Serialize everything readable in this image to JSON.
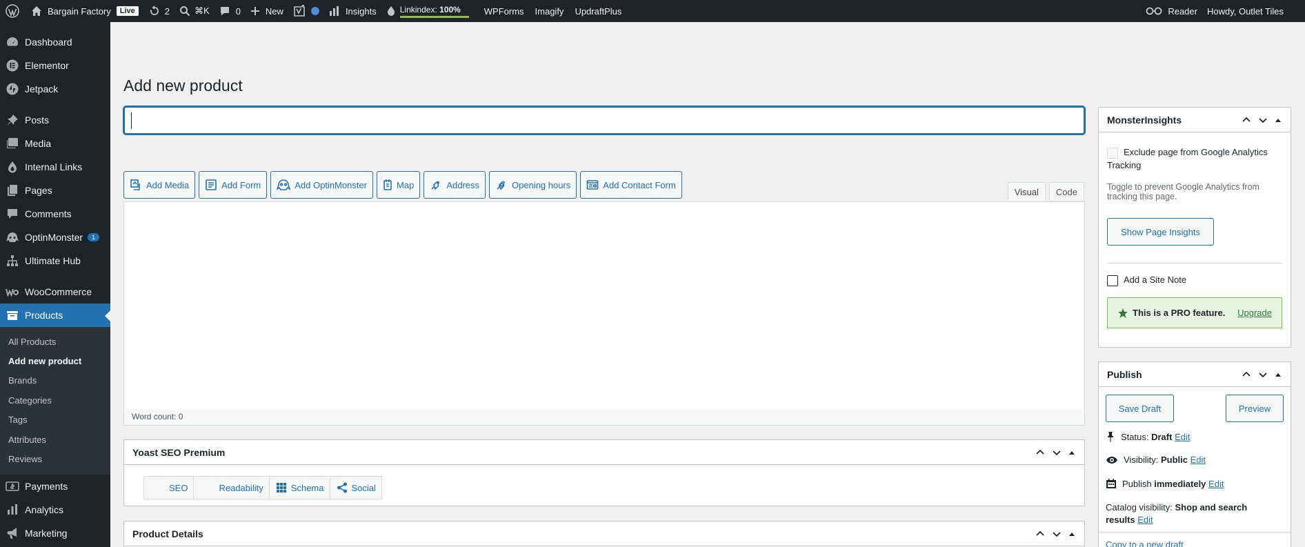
{
  "admin_bar": {
    "site_name": "Bargain Factory",
    "live_badge": "Live",
    "updates_count": "2",
    "search_shortcut": "⌘K",
    "comments_count": "0",
    "new_label": "New",
    "insights_label": "Insights",
    "linkindex_label": "Linkindex:",
    "linkindex_value": "100%",
    "wpforms_label": "WPForms",
    "imagify_label": "Imagify",
    "updraft_label": "UpdraftPlus",
    "reader_label": "Reader",
    "howdy_label": "Howdy, Outlet Tiles"
  },
  "sidebar": {
    "items": [
      {
        "label": "Dashboard",
        "icon": "dashboard-icon"
      },
      {
        "label": "Elementor",
        "icon": "elementor-icon"
      },
      {
        "label": "Jetpack",
        "icon": "jetpack-icon"
      },
      {
        "label": "Posts",
        "icon": "pin-icon"
      },
      {
        "label": "Media",
        "icon": "media-icon"
      },
      {
        "label": "Internal Links",
        "icon": "link-icon"
      },
      {
        "label": "Pages",
        "icon": "pages-icon"
      },
      {
        "label": "Comments",
        "icon": "comment-icon"
      },
      {
        "label": "OptinMonster",
        "icon": "optinmonster-icon",
        "badge": "1"
      },
      {
        "label": "Ultimate Hub",
        "icon": "hub-icon"
      },
      {
        "label": "WooCommerce",
        "icon": "woocommerce-icon"
      },
      {
        "label": "Products",
        "icon": "products-icon"
      },
      {
        "label": "Payments",
        "icon": "payments-icon"
      },
      {
        "label": "Analytics",
        "icon": "analytics-icon"
      },
      {
        "label": "Marketing",
        "icon": "marketing-icon"
      }
    ],
    "products_submenu": [
      "All Products",
      "Add new product",
      "Brands",
      "Categories",
      "Tags",
      "Attributes",
      "Reviews"
    ]
  },
  "main": {
    "page_title": "Add new product",
    "title_input_value": "",
    "media_buttons": [
      "Add Media",
      "Add Form",
      "Add OptinMonster",
      "Map",
      "Address",
      "Opening hours",
      "Add Contact Form"
    ],
    "editor_tabs": [
      "Visual",
      "Code"
    ],
    "word_count": "Word count: 0",
    "yoast": {
      "title": "Yoast SEO Premium",
      "tabs": [
        "SEO",
        "Readability",
        "Schema",
        "Social"
      ]
    },
    "product_details_title": "Product Details"
  },
  "monsterinsights": {
    "title": "MonsterInsights",
    "exclude_label": "Exclude page from Google Analytics Tracking",
    "hint": "Toggle to prevent Google Analytics from tracking this page.",
    "insights_button": "Show Page Insights",
    "site_note_label": "Add a Site Note",
    "pro_text": "This is a PRO feature.",
    "upgrade_link": "Upgrade"
  },
  "publish": {
    "title": "Publish",
    "save_draft": "Save Draft",
    "preview": "Preview",
    "status_label": "Status:",
    "status_value": "Draft",
    "visibility_label": "Visibility:",
    "visibility_value": "Public",
    "publish_label": "Publish",
    "publish_value": "immediately",
    "catalog_label": "Catalog visibility:",
    "catalog_value": "Shop and search results",
    "edit_link": "Edit",
    "copy_link": "Copy to a new draft"
  },
  "colors": {
    "admin_bar_bg": "#1d2327",
    "accent": "#2271b1",
    "pro_green": "#7ac143"
  }
}
